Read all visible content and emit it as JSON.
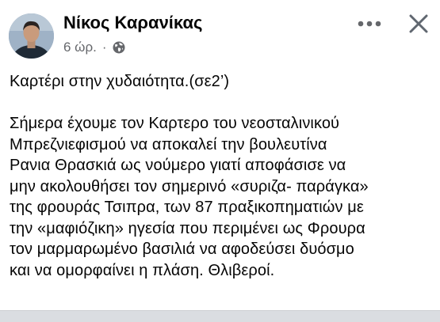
{
  "post": {
    "author": "Νίκος Καρανίκας",
    "timestamp": "6 ώρ.",
    "separator": "·",
    "privacy_icon": "globe-icon",
    "more_icon": "more-horizontal-icon",
    "close_icon": "close-icon",
    "title_line": "Καρτέρι στην χυδαιότητα.(σε2’)",
    "body_lines": [
      "Σήμερα έχουμε τον Καρτερο του νεοσταλινικού",
      "Μπρεζνιεφισμού να αποκαλεί την βουλευτίνα",
      "Ρανια Θρασκιά ως νούμερο γιατί αποφάσισε να",
      "μην ακολουθήσει τον σημερινό «συριζα- παράγκα»",
      "της φρουράς Τσιπρα, των 87 πραξικοπηματιών με",
      "την «μαφιόζικη» ηγεσία που περιμένει ως Φρουρα",
      "τον μαρμαρωμένο βασιλιά να αφοδεύσει δυόσμο",
      "και να ομορφαίνει η πλάση. Θλιβεροί."
    ]
  },
  "colors": {
    "background": "#ffffff",
    "page_edge": "#dadde1",
    "text_primary": "#050505",
    "text_secondary": "#65676b"
  }
}
